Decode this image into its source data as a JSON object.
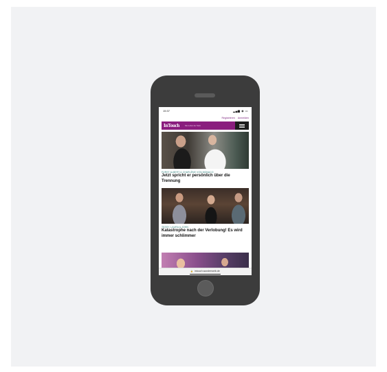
{
  "status_bar": {
    "time": "15:37",
    "icons": "▂▄▆ ◉ ▭"
  },
  "topbar": {
    "register": "Registrieren",
    "login": "Anmelden"
  },
  "nav": {
    "logo": "InTouch",
    "tagline": "Das Leben der Stars"
  },
  "articles": [
    {
      "kicker": "Fürst Albert & Charlène von Monaco",
      "headline": "Jetzt spricht er persönlich über die Trennung"
    },
    {
      "kicker": "Tessy, Laura & John",
      "headline": "Katastrophe nach der Verlobung! Es wird immer schlimmer"
    }
  ],
  "browser": {
    "url": "intouch.wunderweib.de"
  },
  "colors": {
    "brand": "#8a1e7e",
    "kicker": "#2f7f7a",
    "device": "#3c3c3c"
  }
}
